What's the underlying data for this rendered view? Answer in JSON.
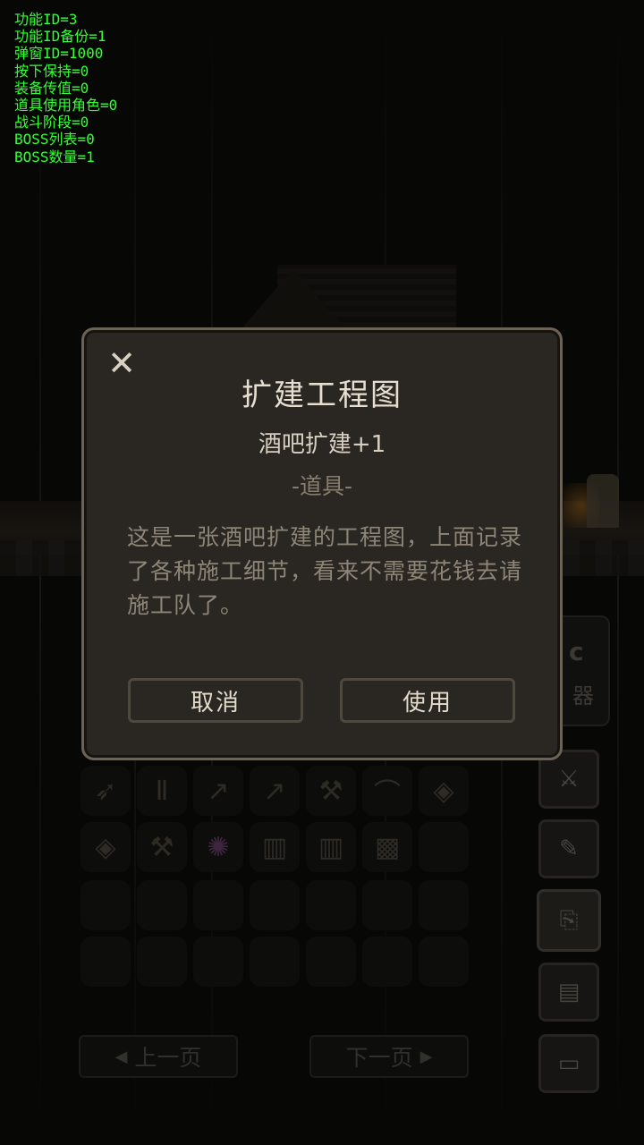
{
  "debug": {
    "lines": [
      "功能ID=3",
      "功能ID备份=1",
      "弹窗ID=1000",
      "按下保持=0",
      "装备传值=0",
      "道具使用角色=0",
      "战斗阶段=0",
      "BOSS列表=0",
      "BOSS数量=1"
    ]
  },
  "side_panel": {
    "letter": "c",
    "label": "器"
  },
  "tabs": [
    {
      "name": "weapon-tab-icon",
      "glyph": "⚔"
    },
    {
      "name": "notes-tab-icon",
      "glyph": "✎"
    },
    {
      "name": "scroll-tab-icon",
      "glyph": "⎘"
    },
    {
      "name": "documents-tab-icon",
      "glyph": "▤"
    },
    {
      "name": "computer-tab-icon",
      "glyph": "▭"
    }
  ],
  "inventory": {
    "row1": [
      {
        "name": "crossbow-icon",
        "glyph": "➶"
      },
      {
        "name": "armor-icon",
        "glyph": "Ⅱ"
      },
      {
        "name": "bow-icon",
        "glyph": "↗"
      },
      {
        "name": "bow-icon",
        "glyph": "↗"
      },
      {
        "name": "hammer-icon",
        "glyph": "⚒"
      },
      {
        "name": "longbow-icon",
        "glyph": "⌒"
      },
      {
        "name": "drop-icon",
        "glyph": "◈"
      }
    ],
    "row2": [
      {
        "name": "drop-icon",
        "glyph": "◈"
      },
      {
        "name": "hammer-icon",
        "glyph": "⚒"
      },
      {
        "name": "orbs-icon",
        "glyph": "✺"
      },
      {
        "name": "scroll-icon",
        "glyph": "▥"
      },
      {
        "name": "scroll-icon",
        "glyph": "▥"
      },
      {
        "name": "blueprint-icon",
        "glyph": "▩"
      },
      {
        "name": "empty-slot",
        "glyph": ""
      }
    ]
  },
  "paging": {
    "prev_label": "上一页",
    "next_label": "下一页",
    "prev_arrow": "◀",
    "next_arrow": "▶"
  },
  "dialog": {
    "close_glyph": "✕",
    "title": "扩建工程图",
    "subtitle": "酒吧扩建+1",
    "type": "-道具-",
    "description": "这是一张酒吧扩建的工程图，上面记录了各种施工细节，看来不需要花钱去请施工队了。",
    "cancel_label": "取消",
    "use_label": "使用"
  }
}
